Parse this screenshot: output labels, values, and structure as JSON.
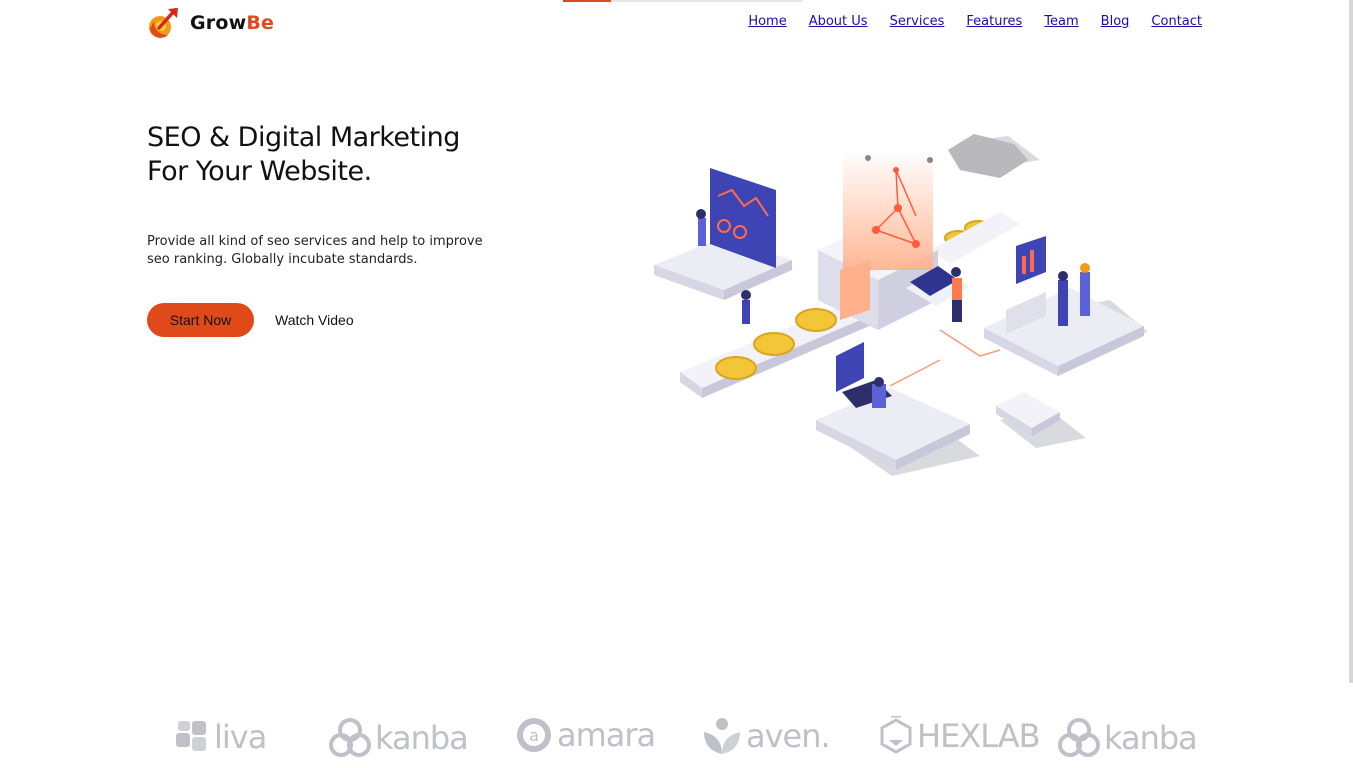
{
  "scroll_progress": 0.2,
  "brand": {
    "name_main": "Grow",
    "name_accent": "Be",
    "logo_icon": "rocket-arrow-icon",
    "accent_color": "#e0491a"
  },
  "nav": {
    "items": [
      "Home",
      "About Us",
      "Services",
      "Features",
      "Team",
      "Blog",
      "Contact"
    ]
  },
  "hero": {
    "title": "SEO & Digital Marketing For Your Website.",
    "description": "Provide all kind of seo services and help to improve seo ranking. Globally incubate standards.",
    "primary_button": "Start Now",
    "secondary_link": "Watch Video",
    "illustration_icon": "isometric-seo-illustration"
  },
  "partners": [
    {
      "name": "liva",
      "icon": "puzzle-icon"
    },
    {
      "name": "kanba",
      "icon": "rings-icon"
    },
    {
      "name": "amara",
      "icon": "badge-icon"
    },
    {
      "name": "aven.",
      "icon": "leaf-heart-icon"
    },
    {
      "name": "HEXLAB",
      "icon": "hexagon-flask-icon"
    },
    {
      "name": "kanba",
      "icon": "rings-icon"
    }
  ]
}
